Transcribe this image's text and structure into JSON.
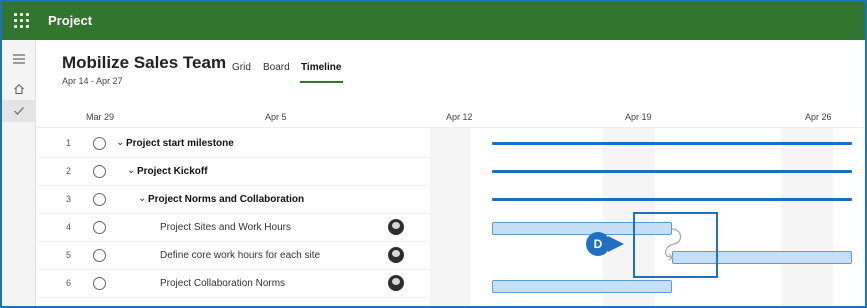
{
  "app": {
    "title": "Project"
  },
  "plan": {
    "title": "Mobilize Sales Team",
    "dates": "Apr 14 - Apr 27"
  },
  "tabs": [
    {
      "label": "Grid",
      "active": false
    },
    {
      "label": "Board",
      "active": false
    },
    {
      "label": "Timeline",
      "active": true
    }
  ],
  "timeline": {
    "date_labels": [
      "Mar 29",
      "Apr 5",
      "Apr 12",
      "Apr 19",
      "Apr 26"
    ]
  },
  "tasks": [
    {
      "num": "1",
      "name": "Project start milestone",
      "bold": true,
      "chevron": true,
      "has_avatar": false
    },
    {
      "num": "2",
      "name": "Project Kickoff",
      "bold": true,
      "chevron": true,
      "has_avatar": false
    },
    {
      "num": "3",
      "name": "Project Norms and Collaboration",
      "bold": true,
      "chevron": true,
      "has_avatar": false
    },
    {
      "num": "4",
      "name": "Project Sites and Work Hours",
      "bold": false,
      "chevron": false,
      "has_avatar": true
    },
    {
      "num": "5",
      "name": "Define core work hours for each site",
      "bold": false,
      "chevron": false,
      "has_avatar": true
    },
    {
      "num": "6",
      "name": "Project Collaboration Norms",
      "bold": false,
      "chevron": false,
      "has_avatar": true
    }
  ],
  "callout": {
    "label": "D"
  },
  "colors": {
    "topbar": "#31752f",
    "accent": "#1f6fc5",
    "milestone": "#1c6fc0",
    "task_fill": "#c5dff6",
    "task_border": "#5b9bd5"
  }
}
